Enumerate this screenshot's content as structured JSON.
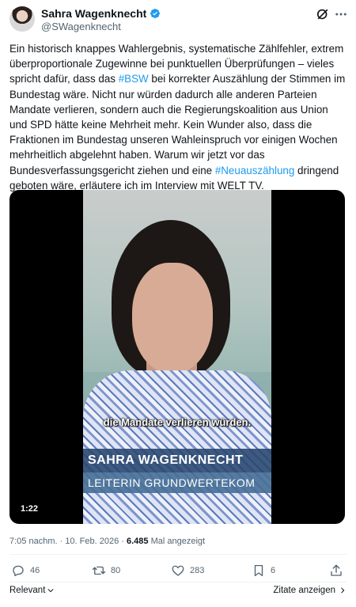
{
  "author": {
    "name": "Sahra Wagenknecht",
    "handle": "@SWagenknecht",
    "verified_color": "#1d9bf0"
  },
  "tweet": {
    "text_1": "Ein historisch knappes Wahlergebnis, systematische Zählfehler, extrem überproportionale Zugewinne bei punktuellen Überprüfungen – vieles spricht dafür, dass das ",
    "hashtag_1": "#BSW",
    "text_2": " bei korrekter Auszählung der Stimmen im Bundestag wäre. Nicht nur würden dadurch alle anderen Parteien Mandate verlieren, sondern auch die Regierungskoalition aus Union und SPD hätte keine Mehrheit mehr. Kein Wunder also, dass die Fraktionen im Bundestag unseren Wahleinspruch vor einigen Wochen mehrheitlich abgelehnt haben. Warum wir jetzt vor das Bundesverfassungsgericht ziehen und eine ",
    "hashtag_2": "#Neuauszählung",
    "text_3": " dringend geboten wäre, erläutere ich im Interview mit WELT TV."
  },
  "video": {
    "subtitle": "die Mandate verlieren würden.",
    "lower_third_name": "SAHRA WAGENKNECHT",
    "lower_third_role": "LEITERIN GRUNDWERTEKOM",
    "duration": "1:22"
  },
  "meta": {
    "time_date": "7:05 nachm. · 10. Feb. 2026 · ",
    "views": "6.485",
    "views_label": " Mal angezeigt"
  },
  "actions": {
    "replies": "46",
    "reposts": "80",
    "likes": "283",
    "bookmarks": "6"
  },
  "footer": {
    "sort_label": "Relevant",
    "quotes_label": "Zitate anzeigen"
  },
  "icons": {
    "verified": "verified-badge-icon",
    "grok": "grok-icon",
    "more": "more-dots-icon",
    "reply": "reply-bubble-icon",
    "repost": "repost-arrows-icon",
    "like": "heart-icon",
    "bookmark": "bookmark-icon",
    "share": "share-upload-icon"
  },
  "colors": {
    "link": "#1d9bf0",
    "secondary_text": "#536471",
    "primary_text": "#0f1419"
  }
}
